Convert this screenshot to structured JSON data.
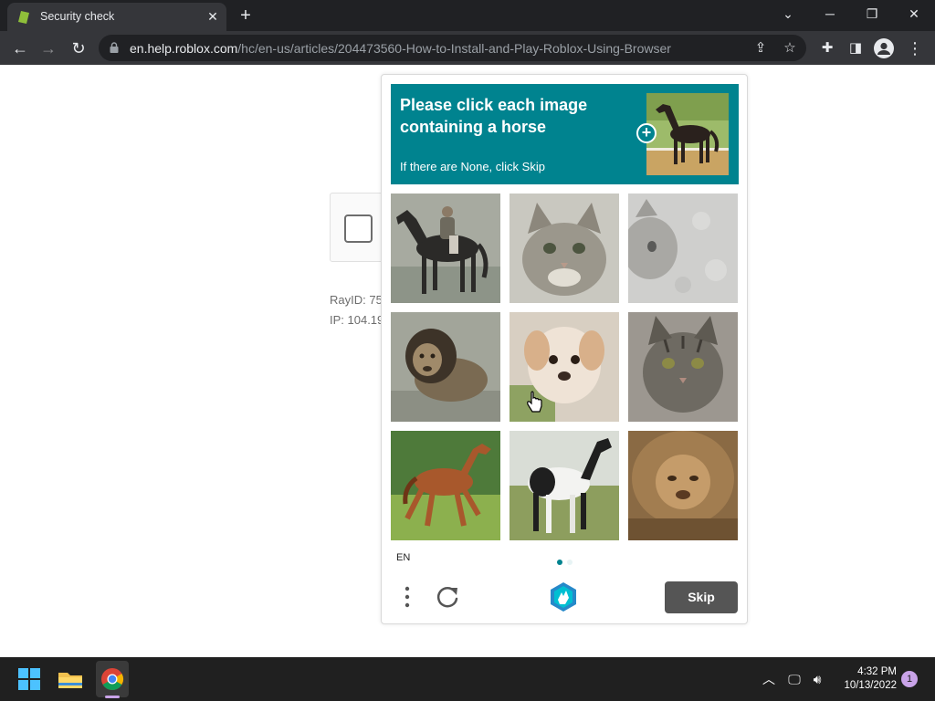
{
  "browser": {
    "tab_title": "Security check",
    "url_host": "en.help.roblox.com",
    "url_path": "/hc/en-us/articles/204473560-How-to-Install-and-Play-Roblox-Using-Browser"
  },
  "page": {
    "ray_id": "RayID: 75",
    "ip": "IP: 104.19"
  },
  "challenge": {
    "prompt": "Please click each image containing a horse",
    "sub": "If there are None, click Skip",
    "language": "EN",
    "skip_label": "Skip",
    "example_icon": "plus-icon",
    "tiles": [
      {
        "subject": "rider-on-horse"
      },
      {
        "subject": "cat"
      },
      {
        "subject": "cat-faint"
      },
      {
        "subject": "lion"
      },
      {
        "subject": "dog"
      },
      {
        "subject": "cat"
      },
      {
        "subject": "brown-horse"
      },
      {
        "subject": "pinto-horse"
      },
      {
        "subject": "lion"
      }
    ],
    "page_dots": 2,
    "active_dot": 1
  },
  "taskbar": {
    "time": "4:32 PM",
    "date": "10/13/2022",
    "notifications": "1"
  },
  "colors": {
    "accent": "#00838f",
    "skip": "#555555"
  }
}
